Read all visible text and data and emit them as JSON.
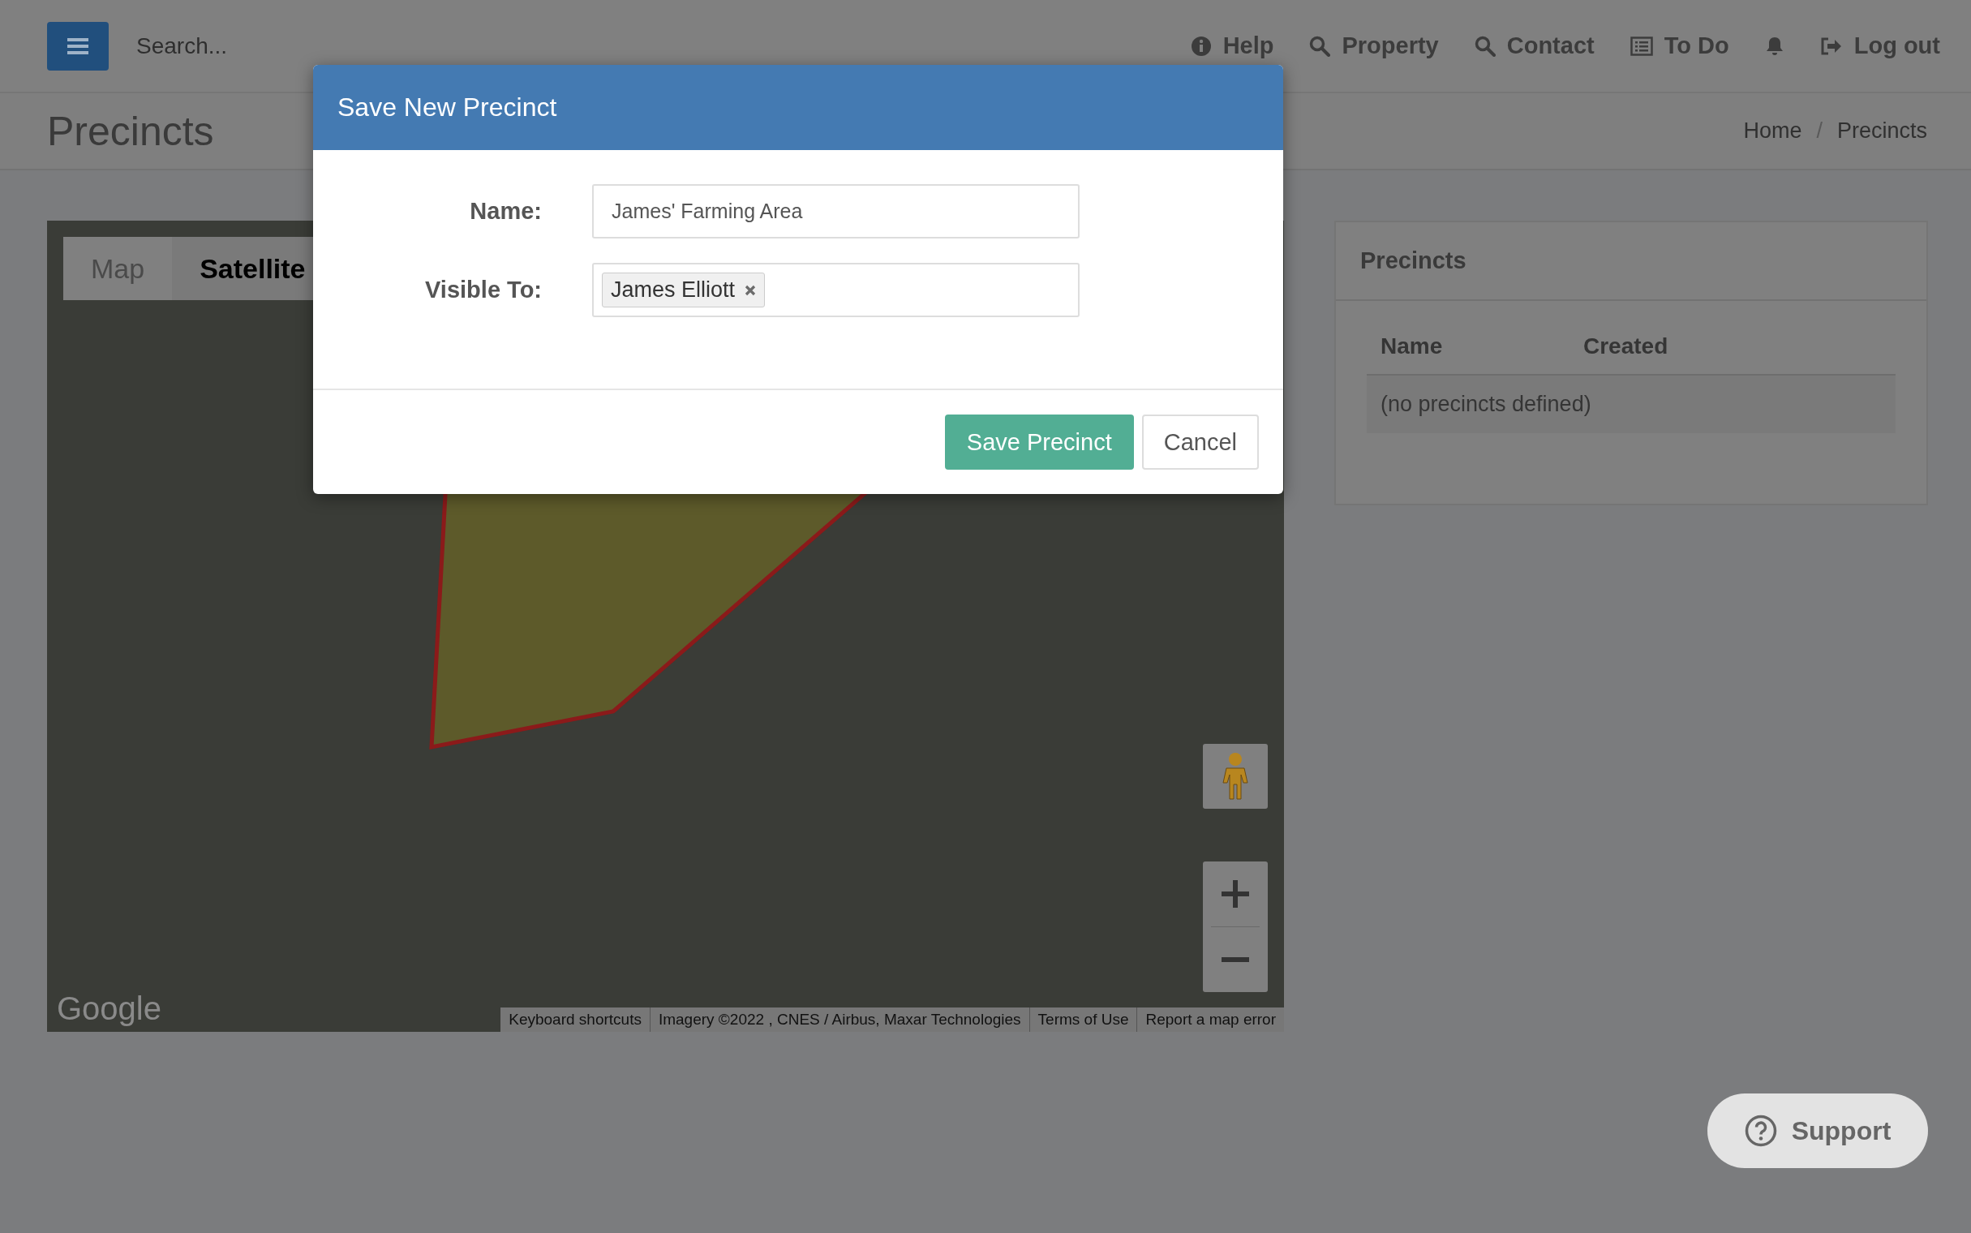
{
  "topbar": {
    "search": {
      "placeholder": "Search..."
    },
    "nav": [
      {
        "label": "Help",
        "kind": "help"
      },
      {
        "label": "Property",
        "kind": "search"
      },
      {
        "label": "Contact",
        "kind": "search"
      },
      {
        "label": "To Do",
        "kind": "todo"
      },
      {
        "label": "Log out",
        "kind": "logout"
      }
    ]
  },
  "header": {
    "title": "Precincts",
    "breadcrumb": [
      "Home",
      "Precincts"
    ],
    "separator": "/"
  },
  "map": {
    "tabs": [
      {
        "label": "Map",
        "selected": false
      },
      {
        "label": "Satellite",
        "selected": true
      }
    ],
    "logo": "Google",
    "attribution": [
      "Keyboard shortcuts",
      "Imagery ©2022 , CNES / Airbus, Maxar Technologies",
      "Terms of Use",
      "Report a map error"
    ]
  },
  "panel": {
    "title": "Precincts",
    "columns": [
      "Name",
      "Created"
    ],
    "empty_message": "(no precincts defined)"
  },
  "modal": {
    "title": "Save New Precinct",
    "fields": [
      {
        "label": "Name:",
        "kind": "text",
        "value": "James' Farming Area"
      },
      {
        "label": "Visible To:",
        "kind": "tags",
        "tags": [
          "James Elliott"
        ]
      }
    ],
    "buttons": [
      {
        "label": "Save Precinct",
        "kind": "primary"
      },
      {
        "label": "Cancel",
        "kind": "default"
      }
    ]
  },
  "support": {
    "label": "Support"
  }
}
